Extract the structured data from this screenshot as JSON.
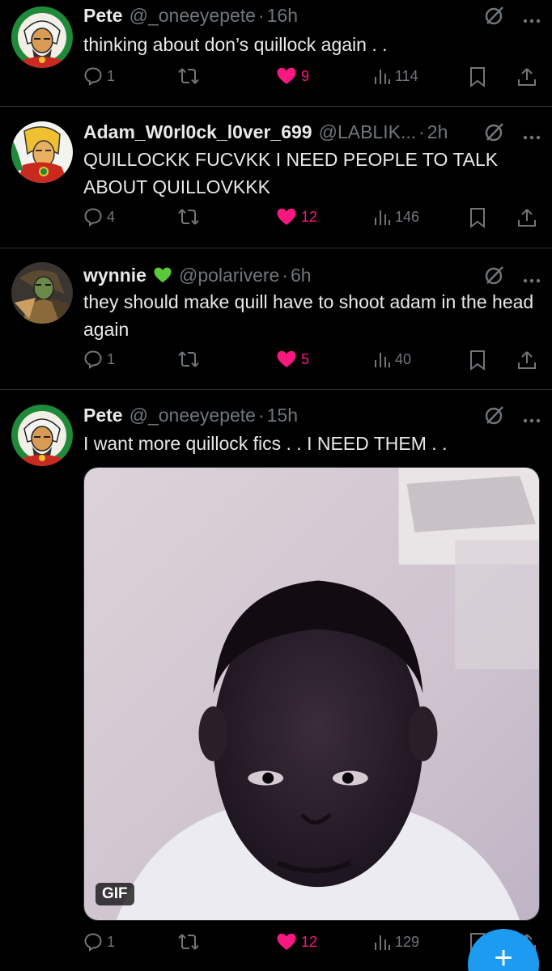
{
  "tweets": [
    {
      "name": "Pete",
      "handle": "@_oneeyepete",
      "time": "16h",
      "text": "thinking about don’s quillock again . .",
      "replies": "1",
      "likes": "9",
      "views": "114"
    },
    {
      "name": "Adam_W0rl0ck_l0ver_699",
      "handle": "@LABLIK...",
      "time": "2h",
      "text": "QUILLOCKK FUCVKK I NEED PEOPLE TO TALK ABOUT QUILLOVKKK",
      "replies": "4",
      "likes": "12",
      "views": "146"
    },
    {
      "name": "wynnie",
      "handle": "@polarivere",
      "time": "6h",
      "text": "they should make quill have to shoot adam in the head again",
      "replies": "1",
      "likes": "5",
      "views": "40"
    },
    {
      "name": "Pete",
      "handle": "@_oneeyepete",
      "time": "15h",
      "text": "I want more quillock fics . . I NEED THEM . .",
      "media_badge": "GIF",
      "replies": "1",
      "likes": "12",
      "views": "129"
    }
  ],
  "fab_label": "+",
  "icons": {
    "reply": "speech-bubble-icon",
    "retweet": "retweet-arrows-icon",
    "like": "heart-icon",
    "views": "bar-chart-icon",
    "bookmark": "bookmark-icon",
    "share": "share-arrow-icon",
    "grok": "grok-slash-icon",
    "more": "ellipsis-icon"
  },
  "colors": {
    "background": "#000000",
    "text": "#e7e9ea",
    "muted": "#71767b",
    "like": "#f91880",
    "accent": "#1d9bf0",
    "divider": "#2f3336"
  }
}
